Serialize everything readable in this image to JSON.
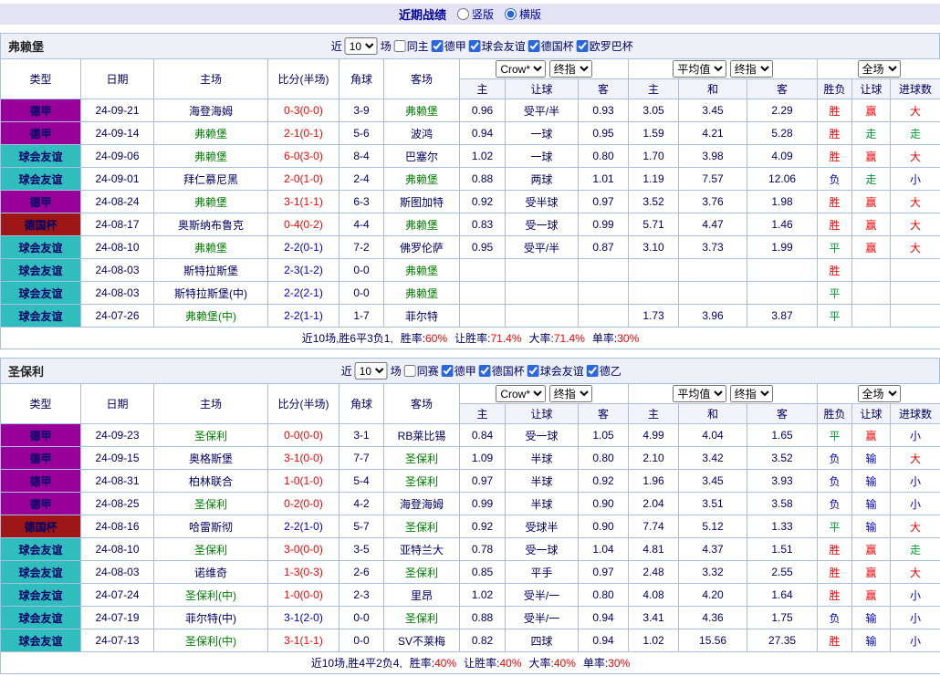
{
  "topbar": {
    "title": "近期战绩",
    "radios": [
      {
        "label": "竖版",
        "selected": false
      },
      {
        "label": "横版",
        "selected": true
      }
    ]
  },
  "colors": {
    "types": {
      "德甲": "#990099",
      "球会友谊": "#2FBDBD",
      "德国杯": "#9E1616"
    },
    "red": "#FF0000",
    "blue": "#0000CC",
    "green": "#009933",
    "focus_team": "#008000",
    "team": "#000066",
    "accent": "#2A66DD",
    "res_map": {
      "胜": "red",
      "平": "green",
      "负": "blue"
    },
    "let_map": {
      "赢": "red",
      "走": "green",
      "输": "blue"
    },
    "goal_map": {
      "大": "red",
      "走": "green",
      "小": "blue"
    }
  },
  "sections": [
    {
      "team": "弗赖堡",
      "filter": {
        "near": "近",
        "count": "10",
        "games": "场",
        "same": "同主",
        "leagues": [
          "德甲",
          "球会友谊",
          "德国杯",
          "欧罗巴杯"
        ]
      },
      "header": {
        "type": "类型",
        "date": "日期",
        "home": "主场",
        "score": "比分(半场)",
        "corner": "角球",
        "away": "客场",
        "odds_source": "Crow*",
        "odds_stage": "终指",
        "avg_source": "平均值",
        "avg_stage": "终指",
        "scope": "全场",
        "sub": [
          "主",
          "让球",
          "客",
          "主",
          "和",
          "客",
          "胜负",
          "让球",
          "进球数"
        ]
      },
      "rows": [
        {
          "type": "德甲",
          "date": "24-09-21",
          "home": "海登海姆",
          "homeFocus": false,
          "score": "0-3(0-0)",
          "scoreColor": "red",
          "corner": "3-9",
          "away": "弗赖堡",
          "awayFocus": true,
          "odds": [
            "0.96",
            "受平/半",
            "0.93",
            "3.05",
            "3.45",
            "2.29"
          ],
          "res": "胜",
          "let": "赢",
          "goal": "大"
        },
        {
          "type": "德甲",
          "date": "24-09-14",
          "home": "弗赖堡",
          "homeFocus": true,
          "score": "2-1(0-1)",
          "scoreColor": "red",
          "corner": "5-6",
          "away": "波鸿",
          "awayFocus": false,
          "odds": [
            "0.94",
            "一球",
            "0.95",
            "1.59",
            "4.21",
            "5.28"
          ],
          "res": "胜",
          "let": "走",
          "goal": "走"
        },
        {
          "type": "球会友谊",
          "date": "24-09-06",
          "home": "弗赖堡",
          "homeFocus": true,
          "score": "6-0(3-0)",
          "scoreColor": "red",
          "corner": "8-4",
          "away": "巴塞尔",
          "awayFocus": false,
          "odds": [
            "1.02",
            "一球",
            "0.80",
            "1.70",
            "3.98",
            "4.09"
          ],
          "res": "胜",
          "let": "赢",
          "goal": "大"
        },
        {
          "type": "球会友谊",
          "date": "24-09-01",
          "home": "拜仁慕尼黑",
          "homeFocus": false,
          "score": "2-0(1-0)",
          "scoreColor": "red",
          "corner": "2-4",
          "away": "弗赖堡",
          "awayFocus": true,
          "odds": [
            "0.88",
            "两球",
            "1.01",
            "1.19",
            "7.57",
            "12.06"
          ],
          "res": "负",
          "let": "走",
          "goal": "小"
        },
        {
          "type": "德甲",
          "date": "24-08-24",
          "home": "弗赖堡",
          "homeFocus": true,
          "score": "3-1(1-1)",
          "scoreColor": "red",
          "corner": "6-3",
          "away": "斯图加特",
          "awayFocus": false,
          "odds": [
            "0.92",
            "受半球",
            "0.97",
            "3.52",
            "3.76",
            "1.98"
          ],
          "res": "胜",
          "let": "赢",
          "goal": "大"
        },
        {
          "type": "德国杯",
          "date": "24-08-17",
          "home": "奥斯纳布鲁克",
          "homeFocus": false,
          "score": "0-4(0-2)",
          "scoreColor": "red",
          "corner": "4-4",
          "away": "弗赖堡",
          "awayFocus": true,
          "odds": [
            "0.83",
            "受一球",
            "0.99",
            "5.71",
            "4.47",
            "1.46"
          ],
          "res": "胜",
          "let": "赢",
          "goal": "大"
        },
        {
          "type": "球会友谊",
          "date": "24-08-10",
          "home": "弗赖堡",
          "homeFocus": true,
          "score": "2-2(0-1)",
          "scoreColor": "blue",
          "corner": "7-2",
          "away": "佛罗伦萨",
          "awayFocus": false,
          "odds": [
            "0.95",
            "受平/半",
            "0.87",
            "3.10",
            "3.73",
            "1.99"
          ],
          "res": "平",
          "let": "赢",
          "goal": "大"
        },
        {
          "type": "球会友谊",
          "date": "24-08-03",
          "home": "斯特拉斯堡",
          "homeFocus": false,
          "score": "2-3(1-2)",
          "scoreColor": "blue",
          "corner": "0-0",
          "away": "弗赖堡",
          "awayFocus": true,
          "odds": [
            "",
            "",
            "",
            "",
            "",
            ""
          ],
          "res": "胜",
          "let": "",
          "goal": ""
        },
        {
          "type": "球会友谊",
          "date": "24-08-03",
          "home": "斯特拉斯堡(中)",
          "homeFocus": false,
          "score": "2-2(2-1)",
          "scoreColor": "blue",
          "corner": "0-0",
          "away": "弗赖堡",
          "awayFocus": true,
          "odds": [
            "",
            "",
            "",
            "",
            "",
            ""
          ],
          "res": "平",
          "let": "",
          "goal": ""
        },
        {
          "type": "球会友谊",
          "date": "24-07-26",
          "home": "弗赖堡(中)",
          "homeFocus": true,
          "score": "2-2(1-1)",
          "scoreColor": "blue",
          "corner": "1-7",
          "away": "菲尔特",
          "awayFocus": false,
          "odds": [
            "",
            "",
            "",
            "1.73",
            "3.96",
            "3.87"
          ],
          "res": "平",
          "let": "",
          "goal": ""
        }
      ],
      "summary": {
        "prefix": "近10场,胜6平3负1,",
        "items": [
          {
            "label": "胜率:",
            "value": "60%"
          },
          {
            "label": "让胜率:",
            "value": "71.4%"
          },
          {
            "label": "大率:",
            "value": "71.4%"
          },
          {
            "label": "单率:",
            "value": "30%"
          }
        ]
      }
    },
    {
      "team": "圣保利",
      "filter": {
        "near": "近",
        "count": "10",
        "games": "场",
        "same": "同赛",
        "leagues": [
          "德甲",
          "德国杯",
          "球会友谊",
          "德乙"
        ]
      },
      "header": {
        "type": "类型",
        "date": "日期",
        "home": "主场",
        "score": "比分(半场)",
        "corner": "角球",
        "away": "客场",
        "odds_source": "Crow*",
        "odds_stage": "终指",
        "avg_source": "平均值",
        "avg_stage": "终指",
        "scope": "全场",
        "sub": [
          "主",
          "让球",
          "客",
          "主",
          "和",
          "客",
          "胜负",
          "让球",
          "进球数"
        ]
      },
      "rows": [
        {
          "type": "德甲",
          "date": "24-09-23",
          "home": "圣保利",
          "homeFocus": true,
          "score": "0-0(0-0)",
          "scoreColor": "red",
          "corner": "3-1",
          "away": "RB莱比锡",
          "awayFocus": false,
          "odds": [
            "0.84",
            "受一球",
            "1.05",
            "4.99",
            "4.04",
            "1.65"
          ],
          "res": "平",
          "let": "赢",
          "goal": "小"
        },
        {
          "type": "德甲",
          "date": "24-09-15",
          "home": "奥格斯堡",
          "homeFocus": false,
          "score": "3-1(0-0)",
          "scoreColor": "red",
          "corner": "7-7",
          "away": "圣保利",
          "awayFocus": true,
          "odds": [
            "1.09",
            "半球",
            "0.80",
            "2.10",
            "3.42",
            "3.52"
          ],
          "res": "负",
          "let": "输",
          "goal": "大"
        },
        {
          "type": "德甲",
          "date": "24-08-31",
          "home": "柏林联合",
          "homeFocus": false,
          "score": "1-0(1-0)",
          "scoreColor": "red",
          "corner": "5-4",
          "away": "圣保利",
          "awayFocus": true,
          "odds": [
            "0.97",
            "半球",
            "0.92",
            "1.96",
            "3.45",
            "3.93"
          ],
          "res": "负",
          "let": "输",
          "goal": "小"
        },
        {
          "type": "德甲",
          "date": "24-08-25",
          "home": "圣保利",
          "homeFocus": true,
          "score": "0-2(0-0)",
          "scoreColor": "red",
          "corner": "4-2",
          "away": "海登海姆",
          "awayFocus": false,
          "odds": [
            "0.99",
            "半球",
            "0.90",
            "2.04",
            "3.51",
            "3.58"
          ],
          "res": "负",
          "let": "输",
          "goal": "小"
        },
        {
          "type": "德国杯",
          "date": "24-08-16",
          "home": "哈雷斯彻",
          "homeFocus": false,
          "score": "2-2(1-0)",
          "scoreColor": "blue",
          "corner": "5-7",
          "away": "圣保利",
          "awayFocus": true,
          "odds": [
            "0.92",
            "受球半",
            "0.90",
            "7.74",
            "5.12",
            "1.33"
          ],
          "res": "平",
          "let": "输",
          "goal": "大"
        },
        {
          "type": "球会友谊",
          "date": "24-08-10",
          "home": "圣保利",
          "homeFocus": true,
          "score": "3-0(0-0)",
          "scoreColor": "red",
          "corner": "3-5",
          "away": "亚特兰大",
          "awayFocus": false,
          "odds": [
            "0.78",
            "受一球",
            "1.04",
            "4.81",
            "4.37",
            "1.51"
          ],
          "res": "胜",
          "let": "赢",
          "goal": "走"
        },
        {
          "type": "球会友谊",
          "date": "24-08-03",
          "home": "诺维奇",
          "homeFocus": false,
          "score": "1-3(0-3)",
          "scoreColor": "red",
          "corner": "2-6",
          "away": "圣保利",
          "awayFocus": true,
          "odds": [
            "0.85",
            "平手",
            "0.97",
            "2.48",
            "3.32",
            "2.55"
          ],
          "res": "胜",
          "let": "赢",
          "goal": "大"
        },
        {
          "type": "球会友谊",
          "date": "24-07-24",
          "home": "圣保利(中)",
          "homeFocus": true,
          "score": "1-0(0-0)",
          "scoreColor": "red",
          "corner": "2-3",
          "away": "里昂",
          "awayFocus": false,
          "odds": [
            "1.02",
            "受半/一",
            "0.80",
            "4.08",
            "4.20",
            "1.64"
          ],
          "res": "胜",
          "let": "赢",
          "goal": "小"
        },
        {
          "type": "球会友谊",
          "date": "24-07-19",
          "home": "菲尔特(中)",
          "homeFocus": false,
          "score": "3-1(2-0)",
          "scoreColor": "blue",
          "corner": "0-0",
          "away": "圣保利",
          "awayFocus": true,
          "odds": [
            "0.88",
            "受半/一",
            "0.94",
            "3.41",
            "4.36",
            "1.75"
          ],
          "res": "负",
          "let": "输",
          "goal": "小"
        },
        {
          "type": "球会友谊",
          "date": "24-07-13",
          "home": "圣保利(中)",
          "homeFocus": true,
          "score": "3-1(1-1)",
          "scoreColor": "red",
          "corner": "0-0",
          "away": "SV不莱梅",
          "awayFocus": false,
          "odds": [
            "0.82",
            "四球",
            "0.94",
            "1.02",
            "15.56",
            "27.35"
          ],
          "res": "胜",
          "let": "输",
          "goal": "小"
        }
      ],
      "summary": {
        "prefix": "近10场,胜4平2负4,",
        "items": [
          {
            "label": "胜率:",
            "value": "40%"
          },
          {
            "label": "让胜率:",
            "value": "40%"
          },
          {
            "label": "大率:",
            "value": "40%"
          },
          {
            "label": "单率:",
            "value": "30%"
          }
        ]
      }
    }
  ]
}
